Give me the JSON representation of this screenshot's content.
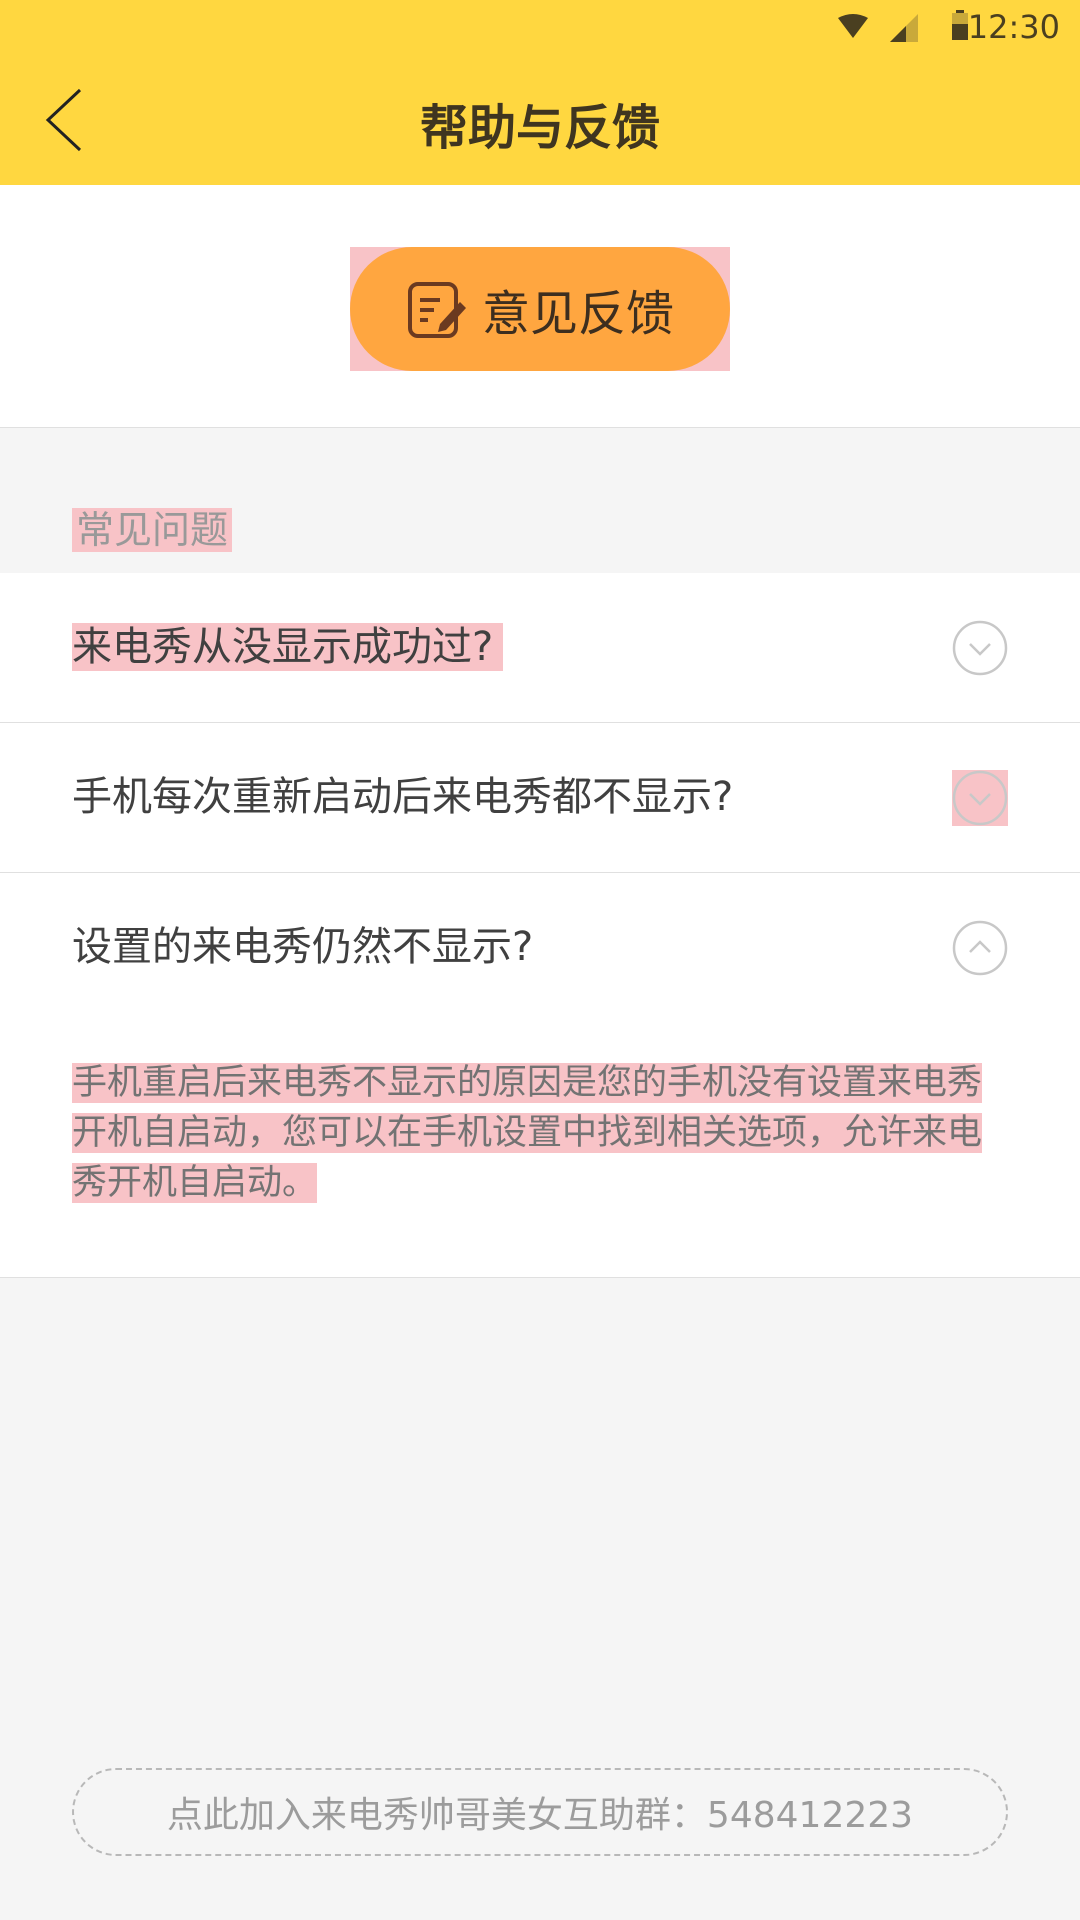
{
  "status_bar": {
    "time": "12:30",
    "icons": [
      "wifi-icon",
      "signal-icon",
      "battery-icon"
    ]
  },
  "header": {
    "title": "帮助与反馈",
    "back_icon": "chevron-left-icon",
    "bg_color": "#ffd740"
  },
  "feedback": {
    "label": "意见反馈",
    "icon": "edit-note-icon",
    "color": "#ffa640"
  },
  "faq": {
    "section_title": "常见问题",
    "items": [
      {
        "question": "来电秀从没显示成功过?",
        "expanded": false
      },
      {
        "question": "手机每次重新启动后来电秀都不显示?",
        "expanded": false
      },
      {
        "question": "设置的来电秀仍然不显示?",
        "expanded": true,
        "answer": "手机重启后来电秀不显示的原因是您的手机没有设置来电秀开机自启动，您可以在手机设置中找到相关选项，允许来电秀开机自启动。"
      }
    ]
  },
  "footer": {
    "join_group_label": "点此加入来电秀帅哥美女互助群：548412223"
  }
}
